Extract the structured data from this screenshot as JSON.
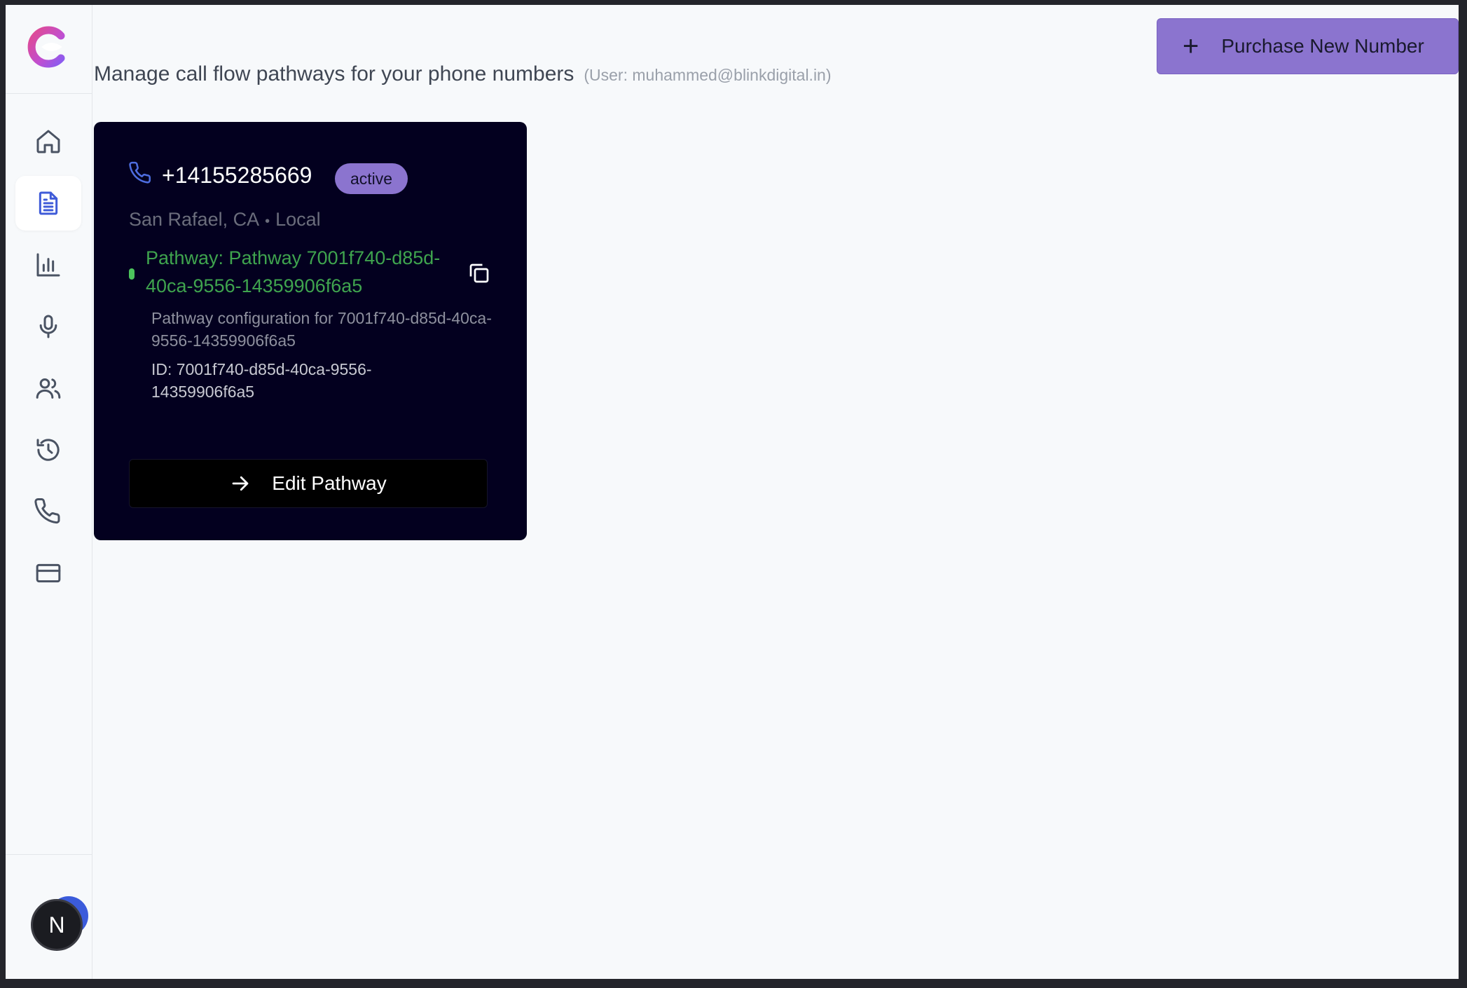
{
  "header": {
    "subtitle": "Manage call flow pathways for your phone numbers",
    "user_note": "(User: muhammed@blinkdigital.in)"
  },
  "actions": {
    "purchase_label": "Purchase New Number",
    "purchase_icon": "plus-icon"
  },
  "sidebar": {
    "items": [
      {
        "icon": "home-icon"
      },
      {
        "icon": "document-icon",
        "active": true
      },
      {
        "icon": "bar-chart-icon"
      },
      {
        "icon": "microphone-icon"
      },
      {
        "icon": "users-icon"
      },
      {
        "icon": "history-icon"
      },
      {
        "icon": "phone-icon"
      },
      {
        "icon": "credit-card-icon"
      }
    ],
    "avatar_letter": "N"
  },
  "numbers": [
    {
      "phone_number": "+14155285669",
      "status": "active",
      "city": "San Rafael, CA",
      "separator": "•",
      "type": "Local",
      "pathway_name": "Pathway: Pathway 7001f740-d85d-40ca-9556-14359906f6a5",
      "pathway_description": "Pathway configuration for 7001f740-d85d-40ca-9556-14359906f6a5",
      "pathway_id": "ID: 7001f740-d85d-40ca-9556-14359906f6a5",
      "edit_label": "Edit Pathway"
    }
  ],
  "colors": {
    "accent": "#8b74cf",
    "card_bg": "#03001f",
    "pathway_green": "#3fa44e",
    "active_nav": "#3f5bd8"
  }
}
